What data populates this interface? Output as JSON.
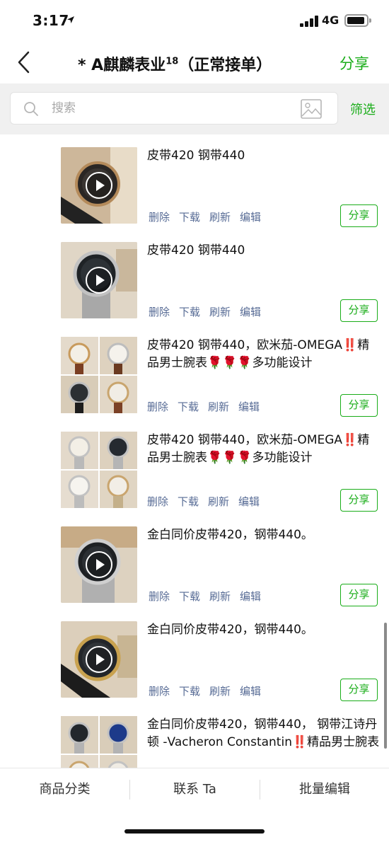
{
  "status": {
    "time": "3:17",
    "network": "4G"
  },
  "nav": {
    "title_main": "* A麒麟表业",
    "title_sup": "18",
    "title_tail": "（正常接单）",
    "share_label": "分享"
  },
  "search": {
    "placeholder": "搜索",
    "filter_label": "筛选"
  },
  "actions": {
    "delete": "删除",
    "download": "下载",
    "refresh": "刷新",
    "edit": "编辑",
    "share": "分享"
  },
  "items": [
    {
      "title": "皮带420 钢带440",
      "media": "video"
    },
    {
      "title": "皮带420 钢带440",
      "media": "video"
    },
    {
      "title": "皮带420 钢带440，欧米茄-OMEGA‼️精品男士腕表🌹🌹🌹多功能设计",
      "media": "grid"
    },
    {
      "title": "皮带420 钢带440，欧米茄-OMEGA‼️精品男士腕表🌹🌹🌹多功能设计",
      "media": "grid"
    },
    {
      "title": "金白同价皮带420，钢带440。",
      "media": "video"
    },
    {
      "title": "金白同价皮带420，钢带440。",
      "media": "video"
    },
    {
      "title": "金白同价皮带420，钢带440， 钢带江诗丹顿 -Vacheron Constantin‼️精品男士腕表",
      "media": "grid"
    }
  ],
  "bottom_bar": {
    "category": "商品分类",
    "contact": "联系 Ta",
    "batch_edit": "批量编辑"
  },
  "colors": {
    "accent": "#1aad19",
    "link": "#576b95",
    "search_bg": "#f0f0f0"
  }
}
